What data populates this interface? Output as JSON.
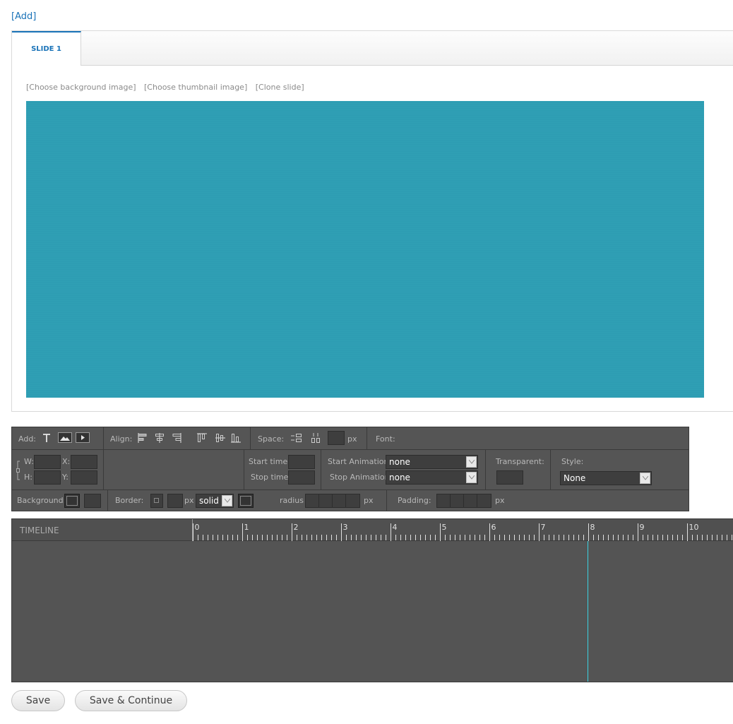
{
  "add_link": "[Add]",
  "tabs": [
    {
      "label": "SLIDE 1"
    }
  ],
  "slide_links": [
    "[Choose background image]",
    "[Choose thumbnail image]",
    "[Clone slide]"
  ],
  "colors": {
    "canvas_bg": "#2e9db3",
    "playhead": "#3bd2e1",
    "accent": "#1a73b8"
  },
  "toolbar": {
    "add_label": "Add:",
    "align_label": "Align:",
    "space_label": "Space:",
    "space_unit": "px",
    "font_label": "Font:",
    "w_label": "W:",
    "h_label": "H:",
    "x_label": "X:",
    "y_label": "Y:",
    "start_time_label": "Start time:",
    "stop_time_label": "Stop time:",
    "start_animation_label": "Start Animation:",
    "start_animation_value": "none",
    "stop_animation_label": "Stop Animation:",
    "stop_animation_value": "none",
    "transparent_label": "Transparent:",
    "style_label": "Style:",
    "style_value": "None",
    "background_label": "Background:",
    "border_label": "Border:",
    "border_unit": "px",
    "border_style_value": "solid",
    "radius_label": "radius",
    "radius_unit": "px",
    "padding_label": "Padding:",
    "padding_unit": "px"
  },
  "timeline": {
    "title": "TIMELINE",
    "ticks": [
      "0",
      "1",
      "2",
      "3",
      "4",
      "5",
      "6",
      "7",
      "8",
      "9",
      "10"
    ],
    "playhead_seconds": 8
  },
  "buttons": {
    "save": "Save",
    "save_continue": "Save & Continue"
  }
}
